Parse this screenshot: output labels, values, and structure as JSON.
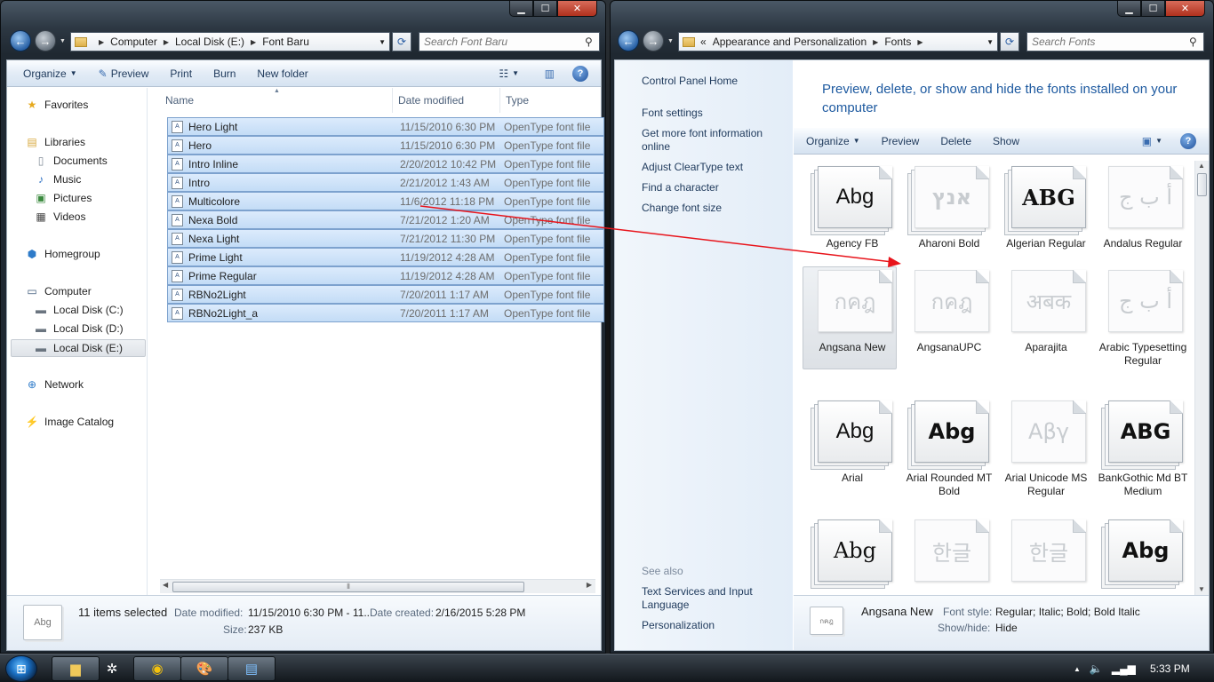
{
  "explorer": {
    "address": [
      "Computer",
      "Local Disk (E:)",
      "Font Baru"
    ],
    "search_placeholder": "Search Font Baru",
    "toolbar": {
      "organize": "Organize",
      "preview": "Preview",
      "print": "Print",
      "burn": "Burn",
      "new_folder": "New folder"
    },
    "nav": {
      "favorites": "Favorites",
      "libraries": "Libraries",
      "documents": "Documents",
      "music": "Music",
      "pictures": "Pictures",
      "videos": "Videos",
      "homegroup": "Homegroup",
      "computer": "Computer",
      "disk_c": "Local Disk (C:)",
      "disk_d": "Local Disk (D:)",
      "disk_e": "Local Disk (E:)",
      "network": "Network",
      "image_catalog": "Image Catalog"
    },
    "columns": {
      "name": "Name",
      "date": "Date modified",
      "type": "Type"
    },
    "files": [
      {
        "name": "Hero Light",
        "date": "11/15/2010 6:30 PM",
        "type": "OpenType font file"
      },
      {
        "name": "Hero",
        "date": "11/15/2010 6:30 PM",
        "type": "OpenType font file"
      },
      {
        "name": "Intro Inline",
        "date": "2/20/2012 10:42 PM",
        "type": "OpenType font file"
      },
      {
        "name": "Intro",
        "date": "2/21/2012 1:43 AM",
        "type": "OpenType font file"
      },
      {
        "name": "Multicolore",
        "date": "11/6/2012 11:18 PM",
        "type": "OpenType font file"
      },
      {
        "name": "Nexa Bold",
        "date": "7/21/2012 1:20 AM",
        "type": "OpenType font file"
      },
      {
        "name": "Nexa Light",
        "date": "7/21/2012 11:30 PM",
        "type": "OpenType font file"
      },
      {
        "name": "Prime Light",
        "date": "11/19/2012 4:28 AM",
        "type": "OpenType font file"
      },
      {
        "name": "Prime Regular",
        "date": "11/19/2012 4:28 AM",
        "type": "OpenType font file"
      },
      {
        "name": "RBNo2Light",
        "date": "7/20/2011 1:17 AM",
        "type": "OpenType font file"
      },
      {
        "name": "RBNo2Light_a",
        "date": "7/20/2011 1:17 AM",
        "type": "OpenType font file"
      }
    ],
    "details": {
      "thumb_text": "Abg",
      "selected": "11 items selected",
      "date_modified_label": "Date modified:",
      "date_modified_value": "11/15/2010 6:30 PM - 11...",
      "date_created_label": "Date created:",
      "date_created_value": "2/16/2015 5:28 PM",
      "size_label": "Size:",
      "size_value": "237 KB"
    }
  },
  "fonts": {
    "address": [
      "Appearance and Personalization",
      "Fonts"
    ],
    "address_prefix": "«",
    "search_placeholder": "Search Fonts",
    "tasks": {
      "home": "Control Panel Home",
      "settings": "Font settings",
      "more_info": "Get more font information online",
      "cleartype": "Adjust ClearType text",
      "find_char": "Find a character",
      "change_size": "Change font size",
      "see_also": "See also",
      "text_services": "Text Services and Input Language",
      "personalization": "Personalization"
    },
    "title": "Preview, delete, or show and hide the fonts installed on your computer",
    "toolbar": {
      "organize": "Organize",
      "preview": "Preview",
      "delete": "Delete",
      "show": "Show"
    },
    "tiles": [
      {
        "name": "Agency FB",
        "sample": "Abg"
      },
      {
        "name": "Aharoni Bold",
        "sample": "אנץ"
      },
      {
        "name": "Algerian Regular",
        "sample": "ABG"
      },
      {
        "name": "Andalus Regular",
        "sample": "أ ب ج"
      },
      {
        "name": "Angsana New",
        "sample": "กคฎ"
      },
      {
        "name": "AngsanaUPC",
        "sample": "กคฎ"
      },
      {
        "name": "Aparajita",
        "sample": "अबक"
      },
      {
        "name": "Arabic Typesetting Regular",
        "sample": "أ ب ج"
      },
      {
        "name": "Arial",
        "sample": "Abg"
      },
      {
        "name": "Arial Rounded MT Bold",
        "sample": "Abg"
      },
      {
        "name": "Arial Unicode MS Regular",
        "sample": "Αβγ"
      },
      {
        "name": "BankGothic Md BT Medium",
        "sample": "ABG"
      },
      {
        "name": "",
        "sample": "Abg"
      },
      {
        "name": "",
        "sample": "한글"
      },
      {
        "name": "",
        "sample": "한글"
      },
      {
        "name": "",
        "sample": "Abg"
      }
    ],
    "details": {
      "thumb_text": "กคฎ",
      "name": "Angsana New",
      "style_label": "Font style:",
      "style_value": "Regular; Italic; Bold; Bold Italic",
      "showhide_label": "Show/hide:",
      "showhide_value": "Hide"
    }
  },
  "taskbar": {
    "time": "5:33 PM"
  },
  "colors": {
    "arrow": "#e8141b",
    "title": "#1e5aa0",
    "link": "#1e395b"
  }
}
